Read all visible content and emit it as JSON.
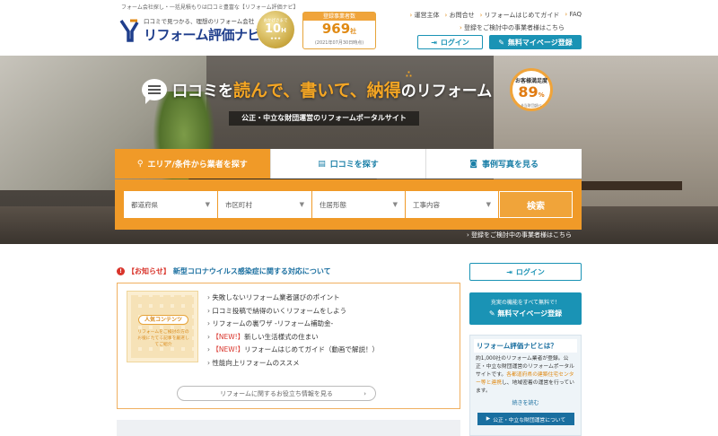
{
  "header": {
    "tagline": "フォーム会社探し・一括見積もりは口コミ豊富な【リフォーム評価ナビ】",
    "logo_catch": "口コミで見つかる、理想のリフォーム会社",
    "logo_name": "リフォーム評価ナビ",
    "medal": {
      "top": "おかげさまで",
      "num": "10",
      "unit": "H",
      "stars": "★★★"
    },
    "count": {
      "label": "登録事業者数",
      "value": "969",
      "unit": "社",
      "date": "(2021年07月30日時点)"
    },
    "nav": [
      "運営主体",
      "お問合せ",
      "リフォームはじめてガイド",
      "FAQ"
    ],
    "nav_line2": "登録をご検討中の事業者様はこちら",
    "login_label": "ログイン",
    "register_label": "無料マイページ登録"
  },
  "hero": {
    "title_a": "口コミを",
    "title_b": "読んで、書いて、納得",
    "title_c": "のリフォーム",
    "subtitle": "公正・中立な財団運営のリフォームポータルサイト",
    "satisfaction": {
      "label": "お客様満足度",
      "value": "89",
      "unit": "%",
      "note": "※当財団調べ"
    },
    "tabs": [
      "エリア/条件から業者を探す",
      "口コミを探す",
      "事例写真を見る"
    ],
    "selects": [
      "都道府県",
      "市区町村",
      "住居形態",
      "工事内容"
    ],
    "search_label": "検索",
    "business_link": "登録をご検討中の事業者様はこちら"
  },
  "notice": {
    "tag": "【お知らせ】",
    "title": "新型コロナウイルス感染症に関する対応について"
  },
  "popular": {
    "badge": "人気コンテンツ",
    "text": "リフォームをご検討の方のお役にたてる記事を厳選してご紹介",
    "links": [
      {
        "new": "",
        "text": "失敗しないリフォーム業者選びのポイント"
      },
      {
        "new": "",
        "text": "口コミ投稿で納得のいくリフォームをしよう"
      },
      {
        "new": "",
        "text": "リフォームの裏ワザ -リフォーム補助金-"
      },
      {
        "new": "【NEW!】",
        "text": "新しい生活様式の住まい"
      },
      {
        "new": "【NEW!】",
        "text": "リフォームはじめてガイド（動画で解説！）"
      },
      {
        "new": "",
        "text": "性能向上リフォームのススメ"
      }
    ],
    "more_label": "リフォームに関するお役立ち情報を見る"
  },
  "sidebar": {
    "login_label": "ログイン",
    "reg_sub": "充実の機能をすべて無料で！",
    "reg_main": "無料マイページ登録",
    "about_title": "リフォーム評価ナビとは？",
    "about_p1": "約1,000社のリフォーム業者が登録。公正・中立な財団運営のリフォームポータルサイトです。",
    "about_hl": "各都道府県の建築住宅センター等と連携",
    "about_p2": "し、地域密着の運営を行っています。",
    "about_more": "続きを読む",
    "about_btn": "公正・中立な財団運営について"
  },
  "colors": {
    "accent": "#f09a28",
    "brand_blue": "#1a93b5",
    "navy": "#1f3e8c"
  }
}
